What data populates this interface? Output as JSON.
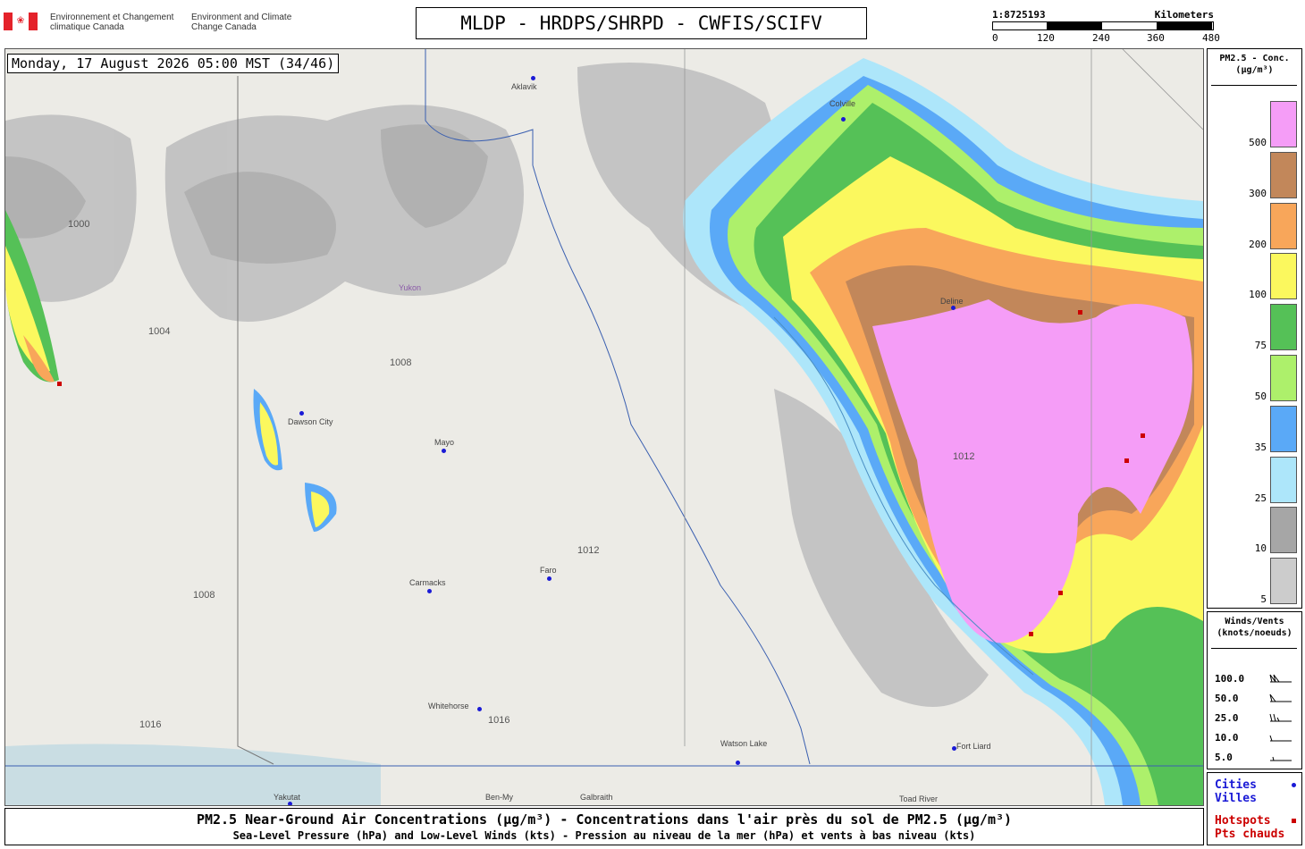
{
  "header": {
    "org_fr": "Environnement et Changement climatique Canada",
    "org_en": "Environment and Climate Change Canada",
    "title": "MLDP - HRDPS/SHRPD - CWFIS/SCIFV",
    "flag_icon": "canada-flag-icon"
  },
  "scale": {
    "ratio": "1:8725193",
    "unit": "Kilometers",
    "ticks": [
      "0",
      "120",
      "240",
      "360",
      "480"
    ]
  },
  "map": {
    "timestamp": "Monday, 17 August 2026 05:00 MST (34/46)",
    "cities": [
      {
        "name": "Aklavik",
        "label": "Aklavik"
      },
      {
        "name": "Colville",
        "label": "Colville"
      },
      {
        "name": "Deline",
        "label": "Deline"
      },
      {
        "name": "Dawson City",
        "label": "Dawson City"
      },
      {
        "name": "Mayo",
        "label": "Mayo"
      },
      {
        "name": "Carmacks",
        "label": "Carmacks"
      },
      {
        "name": "Faro",
        "label": "Faro"
      },
      {
        "name": "Whitehorse",
        "label": "Whitehorse"
      },
      {
        "name": "Watson Lake",
        "label": "Watson Lake"
      },
      {
        "name": "Fort Liard",
        "label": "Fort Liard"
      },
      {
        "name": "Yakutat",
        "label": "Yakutat"
      },
      {
        "name": "Ben-My",
        "label": "Ben-My"
      },
      {
        "name": "Galbraith",
        "label": "Galbraith"
      },
      {
        "name": "Toad River",
        "label": "Toad River"
      },
      {
        "name": "Yukon",
        "label": "Yukon"
      }
    ],
    "isobars": [
      "1000",
      "1004",
      "1008",
      "1012",
      "1016"
    ]
  },
  "legend": {
    "title_line1": "PM2.5 - Conc.",
    "title_line2": "(µg/m³)",
    "levels": [
      {
        "label": "500",
        "color": "#f59df7"
      },
      {
        "label": "300",
        "color": "#c2875a"
      },
      {
        "label": "200",
        "color": "#f8a65a"
      },
      {
        "label": "100",
        "color": "#fbf85e"
      },
      {
        "label": "75",
        "color": "#55c157"
      },
      {
        "label": "50",
        "color": "#adf06b"
      },
      {
        "label": "35",
        "color": "#5aa9f7"
      },
      {
        "label": "25",
        "color": "#ade6fa"
      },
      {
        "label": "10",
        "color": "#a6a6a6"
      },
      {
        "label": "5",
        "color": "#cccccc"
      }
    ]
  },
  "winds": {
    "title_line1": "Winds/Vents",
    "title_line2": "(knots/noeuds)",
    "rows": [
      "100.0",
      "50.0",
      "25.0",
      "10.0",
      "5.0"
    ]
  },
  "markers": {
    "cities_en": "Cities",
    "cities_fr": "Villes",
    "hotspots_en": "Hotspots",
    "hotspots_fr": "Pts chauds",
    "city_color": "#1a1ad6",
    "hotspot_color": "#cc0000"
  },
  "footer": {
    "line1": "PM2.5 Near-Ground Air Concentrations (µg/m³) - Concentrations dans l'air près du sol de PM2.5 (µg/m³)",
    "line2": "Sea-Level Pressure (hPa) and Low-Level Winds (kts) - Pression au niveau de la mer (hPa) et vents à bas niveau (kts)"
  }
}
